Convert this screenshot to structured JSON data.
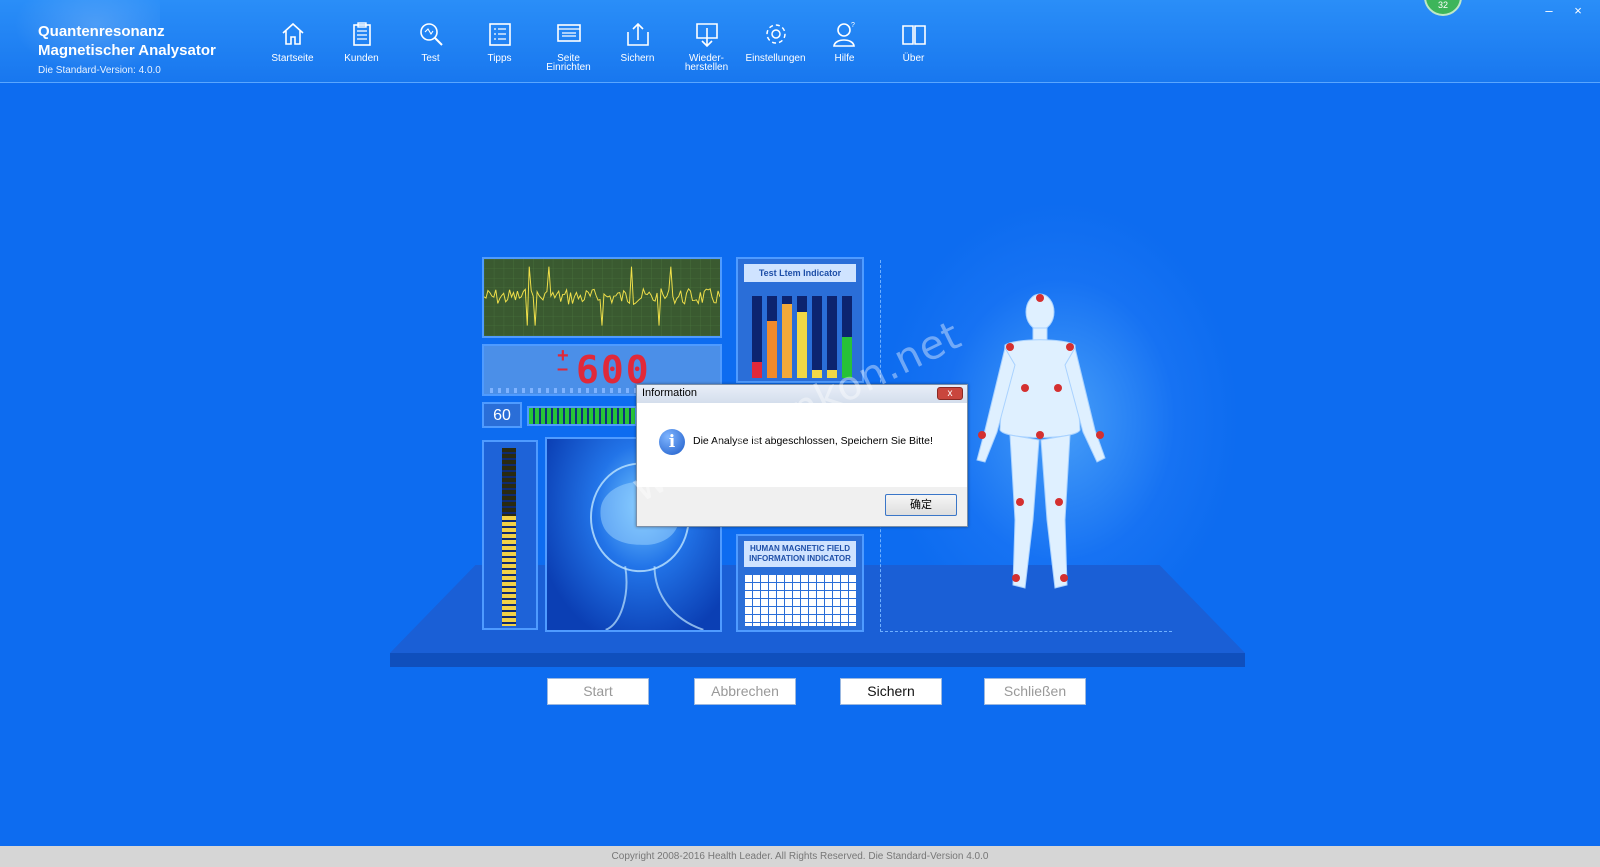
{
  "app": {
    "title_line1": "Quantenresonanz",
    "title_line2": "Magnetischer Analysator",
    "version": "Die Standard-Version: 4.0.0",
    "badge": "32"
  },
  "nav": [
    {
      "label": "Startseite",
      "icon": "home-icon"
    },
    {
      "label": "Kunden",
      "icon": "clipboard-icon"
    },
    {
      "label": "Test",
      "icon": "search-icon"
    },
    {
      "label": "Tipps",
      "icon": "list-icon"
    },
    {
      "label": "Seite\nEinrichten",
      "icon": "page-setup-icon"
    },
    {
      "label": "Sichern",
      "icon": "upload-icon"
    },
    {
      "label": "Wieder-\nherstellen",
      "icon": "download-icon"
    },
    {
      "label": "Einstellungen",
      "icon": "gear-icon"
    },
    {
      "label": "Hilfe",
      "icon": "user-help-icon"
    },
    {
      "label": "Über",
      "icon": "book-icon"
    }
  ],
  "window": {
    "minimize": "–",
    "close": "×"
  },
  "instrument": {
    "digits": "600",
    "sign": "+\n–",
    "counter": "60",
    "test_indicator_title": "Test Ltem Indicator",
    "test_indicator_levels": [
      0.2,
      0.7,
      0.9,
      0.8,
      0.1,
      0.1,
      0.5
    ],
    "test_indicator_colors": [
      "#e0293a",
      "#f08a2a",
      "#f2a93a",
      "#f2d846",
      "#f2d846",
      "#f2d846",
      "#27c238"
    ],
    "magnetic_title": "HUMAN MAGNETIC FIELD INFORMATION INDICATOR",
    "meter_level": 0.62
  },
  "buttons": {
    "start": "Start",
    "cancel": "Abbrechen",
    "save": "Sichern",
    "close": "Schließen"
  },
  "dialog": {
    "title": "Information",
    "close": "x",
    "message": "Die Analyse ist abgeschlossen, Speichern Sie Bitte!",
    "ok": "确定"
  },
  "watermark": "www.monkon.net",
  "footer": "Copyright 2008-2016 Health Leader. All Rights Reserved.  Die Standard-Version 4.0.0"
}
